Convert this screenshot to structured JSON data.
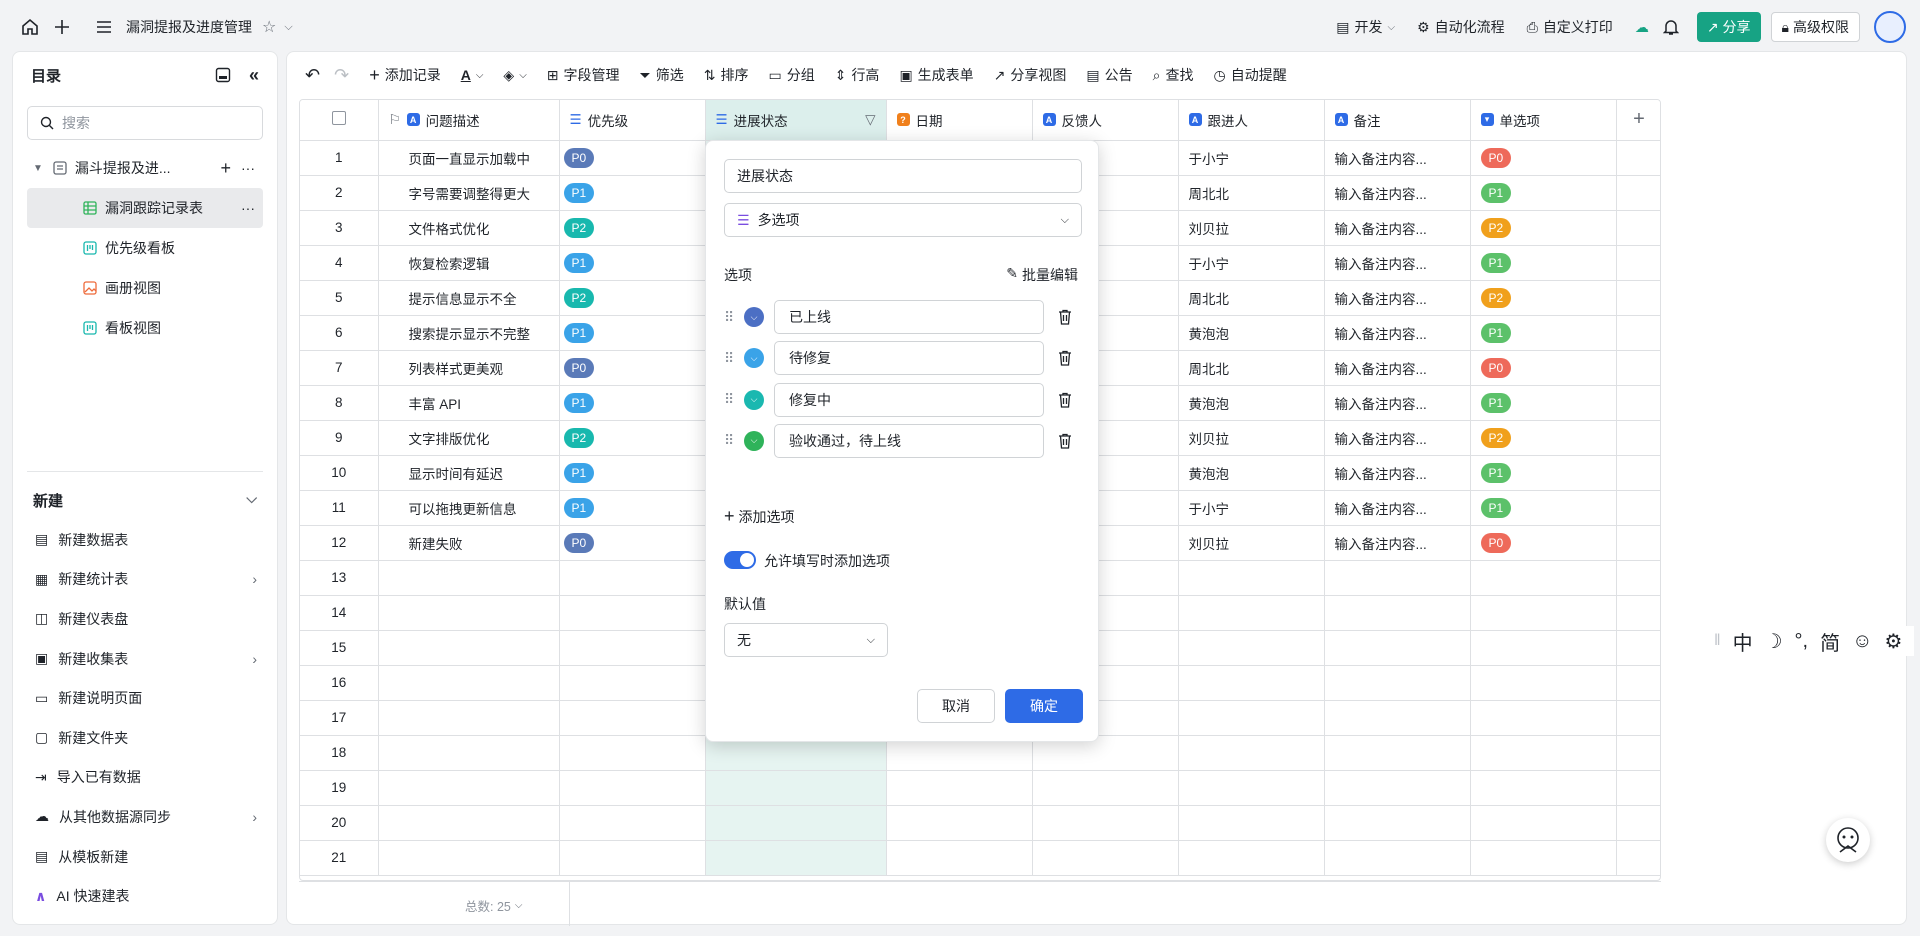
{
  "topbar": {
    "doc_title": "漏洞提报及进度管理",
    "dev": "开发",
    "automation": "自动化流程",
    "custom_print": "自定义打印",
    "share": "分享",
    "advanced_perm": "高级权限"
  },
  "sidebar": {
    "title": "目录",
    "search_placeholder": "搜索",
    "tree": [
      {
        "label": "漏斗提报及进..."
      },
      {
        "label": "漏洞跟踪记录表"
      },
      {
        "label": "优先级看板"
      },
      {
        "label": "画册视图"
      },
      {
        "label": "看板视图"
      }
    ],
    "new_title": "新建",
    "new_items": [
      {
        "label": "新建数据表"
      },
      {
        "label": "新建统计表"
      },
      {
        "label": "新建仪表盘"
      },
      {
        "label": "新建收集表"
      },
      {
        "label": "新建说明页面"
      },
      {
        "label": "新建文件夹"
      },
      {
        "label": "导入已有数据"
      },
      {
        "label": "从其他数据源同步"
      },
      {
        "label": "从模板新建"
      },
      {
        "label": "AI 快速建表"
      }
    ]
  },
  "toolbar": {
    "add_record": "添加记录",
    "field_manage": "字段管理",
    "filter": "筛选",
    "sort": "排序",
    "group": "分组",
    "row_height": "行高",
    "generate_form": "生成表单",
    "share_view": "分享视图",
    "notice": "公告",
    "find": "查找",
    "auto_remind": "自动提醒"
  },
  "table": {
    "headers": {
      "desc": "问题描述",
      "priority": "优先级",
      "status": "进展状态",
      "date": "日期",
      "reporter": "反馈人",
      "follower": "跟进人",
      "note": "备注",
      "single": "单选项"
    },
    "rows": [
      {
        "num": "1",
        "desc": "页面一直显示加载中",
        "priority": "P0",
        "follower": "于小宁",
        "note": "输入备注内容...",
        "single": "P0"
      },
      {
        "num": "2",
        "desc": "字号需要调整得更大",
        "priority": "P1",
        "follower": "周北北",
        "note": "输入备注内容...",
        "single": "P1"
      },
      {
        "num": "3",
        "desc": "文件格式优化",
        "priority": "P2",
        "follower": "刘贝拉",
        "note": "输入备注内容...",
        "single": "P2"
      },
      {
        "num": "4",
        "desc": "恢复检索逻辑",
        "priority": "P1",
        "follower": "于小宁",
        "note": "输入备注内容...",
        "single": "P1"
      },
      {
        "num": "5",
        "desc": "提示信息显示不全",
        "priority": "P2",
        "follower": "周北北",
        "note": "输入备注内容...",
        "single": "P2"
      },
      {
        "num": "6",
        "desc": "搜索提示显示不完整",
        "priority": "P1",
        "follower": "黄泡泡",
        "note": "输入备注内容...",
        "single": "P1"
      },
      {
        "num": "7",
        "desc": "列表样式更美观",
        "priority": "P0",
        "follower": "周北北",
        "note": "输入备注内容...",
        "single": "P0"
      },
      {
        "num": "8",
        "desc": "丰富 API",
        "priority": "P1",
        "follower": "黄泡泡",
        "note": "输入备注内容...",
        "single": "P1"
      },
      {
        "num": "9",
        "desc": "文字排版优化",
        "priority": "P2",
        "follower": "刘贝拉",
        "note": "输入备注内容...",
        "single": "P2"
      },
      {
        "num": "10",
        "desc": "显示时间有延迟",
        "priority": "P1",
        "follower": "黄泡泡",
        "note": "输入备注内容...",
        "single": "P1"
      },
      {
        "num": "11",
        "desc": "可以拖拽更新信息",
        "priority": "P1",
        "follower": "于小宁",
        "note": "输入备注内容...",
        "single": "P1"
      },
      {
        "num": "12",
        "desc": "新建失败",
        "priority": "P0",
        "follower": "刘贝拉",
        "note": "输入备注内容...",
        "single": "P0"
      }
    ],
    "empty_rows": [
      "13",
      "14",
      "15",
      "16",
      "17",
      "18",
      "19",
      "20",
      "21"
    ],
    "footer_total": "总数: 25"
  },
  "popup": {
    "field_name": "进展状态",
    "field_type": "多选项",
    "options_label": "选项",
    "batch_edit": "批量编辑",
    "options": [
      {
        "label": "已上线",
        "color": "#4c6fc4"
      },
      {
        "label": "待修复",
        "color": "#3aa3e8"
      },
      {
        "label": "修复中",
        "color": "#1ab8b0"
      },
      {
        "label": "验收通过，待上线",
        "color": "#2fb35a"
      }
    ],
    "add_option": "添加选项",
    "allow_add": "允许填写时添加选项",
    "default_label": "默认值",
    "default_value": "无",
    "cancel": "取消",
    "confirm": "确定"
  },
  "colors": {
    "P0": "#5a7ab8",
    "P1": "#3aa3e8",
    "P2": "#18b8ae",
    "S0": "#ee6a5a",
    "S1": "#5cc16a",
    "S2": "#f0a01c",
    "accent": "#2e6be6",
    "share": "#17a384"
  },
  "ime": {
    "labels": [
      "中",
      "简"
    ]
  }
}
